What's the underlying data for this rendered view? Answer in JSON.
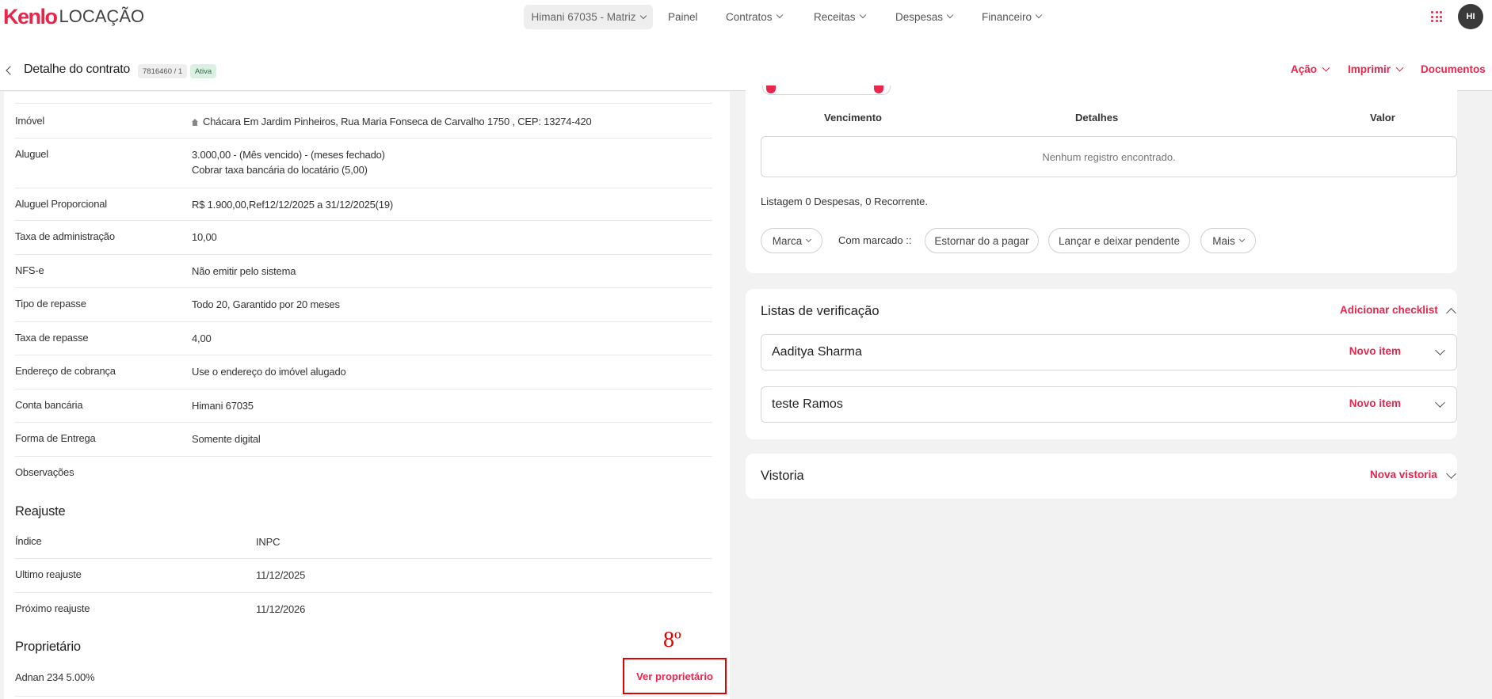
{
  "brand": {
    "logo_main": "Kenlo",
    "logo_sub": "LOCAÇÃO",
    "accent_color": "#e8264c"
  },
  "nav": {
    "tenant": "Himani 67035 - Matriz",
    "items": [
      "Painel",
      "Contratos",
      "Receitas",
      "Despesas",
      "Financeiro"
    ],
    "avatar": "HI",
    "apps_icon": "apps-grid-icon"
  },
  "header": {
    "title": "Detalhe do contrato",
    "contract_id": "7816460 / 1",
    "status": "Ativa",
    "actions": {
      "acao": "Ação",
      "imprimir": "Imprimir",
      "documentos": "Documentos"
    }
  },
  "details": [
    {
      "label": "Imóvel",
      "value": "Chácara Em Jardim Pinheiros, Rua Maria Fonseca de Carvalho 1750 , CEP: 13274-420"
    },
    {
      "label": "Aluguel",
      "value": "3.000,00 - (Mês vencido) - (meses fechado)",
      "value2": "Cobrar taxa bancária do locatário (5,00)"
    },
    {
      "label": "Aluguel Proporcional",
      "value": "R$ 1.900,00,Ref12/12/2025 a 31/12/2025(19)"
    },
    {
      "label": "Taxa de administração",
      "value": "10,00"
    },
    {
      "label": "NFS-e",
      "value": "Não emitir pelo sistema"
    },
    {
      "label": "Tipo de repasse",
      "value": "Todo 20, Garantido por 20 meses"
    },
    {
      "label": "Taxa de repasse",
      "value": "4,00"
    },
    {
      "label": "Endereço de cobrança",
      "value": "Use o endereço do imóvel alugado"
    },
    {
      "label": "Conta bancária",
      "value": "Himani 67035"
    },
    {
      "label": "Forma de Entrega",
      "value": "Somente digital"
    },
    {
      "label": "Observações",
      "value": ""
    }
  ],
  "reajuste": {
    "title": "Reajuste",
    "rows": [
      {
        "label": "Índice",
        "value": "INPC"
      },
      {
        "label": "Ultimo reajuste",
        "value": "11/12/2025"
      },
      {
        "label": "Próximo reajuste",
        "value": "11/12/2026"
      }
    ]
  },
  "proprietario": {
    "title": "Proprietário",
    "owner": "Adnan 234 5.00%",
    "button": "Ver proprietário",
    "marker": "8º"
  },
  "despesas": {
    "columns": [
      "Vencimento",
      "Detalhes",
      "Valor"
    ],
    "empty": "Nenhum registro encontrado.",
    "listing": "Listagem 0 Despesas, 0 Recorrente.",
    "marca": "Marca",
    "com_marcado": "Com marcado ::",
    "estornar": "Estornar do a pagar",
    "lancar": "Lançar e deixar pendente",
    "mais": "Mais"
  },
  "checklists": {
    "title": "Listas de verificação",
    "add": "Adicionar checklist",
    "items": [
      {
        "name": "Aaditya Sharma",
        "action": "Novo item"
      },
      {
        "name": "teste Ramos",
        "action": "Novo item"
      }
    ]
  },
  "vistoria": {
    "title": "Vistoria",
    "action": "Nova vistoria"
  }
}
